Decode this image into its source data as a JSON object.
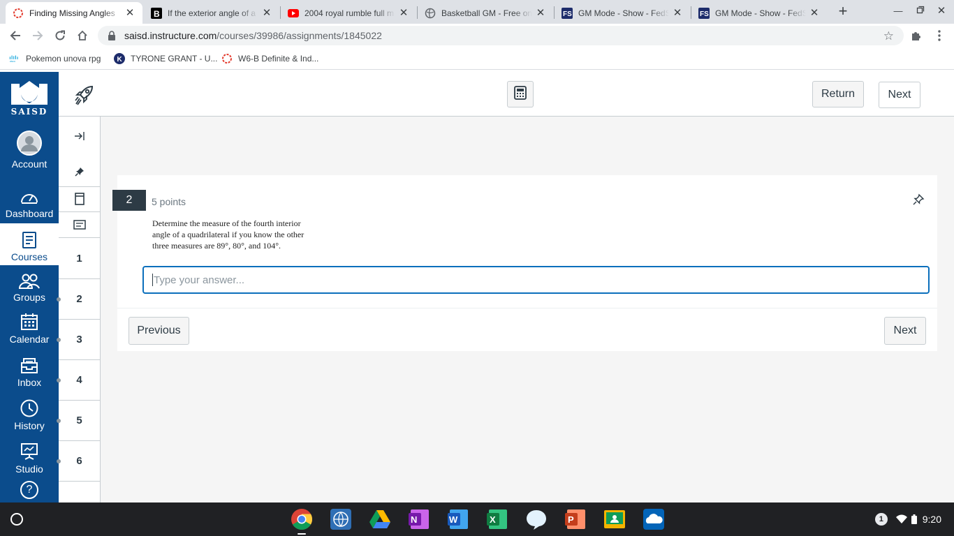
{
  "browser": {
    "tabs": [
      {
        "title": "Finding Missing Angles",
        "active": true
      },
      {
        "title": "If the exterior angle of a",
        "active": false
      },
      {
        "title": "2004 royal rumble full m",
        "active": false
      },
      {
        "title": "Basketball GM - Free onli",
        "active": false
      },
      {
        "title": "GM Mode - Show - FedSi",
        "active": false
      },
      {
        "title": "GM Mode - Show - FedSi",
        "active": false
      }
    ],
    "new_tab": "+",
    "url_host": "saisd.instructure.com",
    "url_path": "/courses/39986/assignments/1845022",
    "bookmarks": [
      {
        "label": "Pokemon unova rpg"
      },
      {
        "label": "TYRONE GRANT - U..."
      },
      {
        "label": "W6-B Definite & Ind..."
      }
    ]
  },
  "nav": {
    "logo_text": "SAISD",
    "items": [
      {
        "label": "Account"
      },
      {
        "label": "Dashboard"
      },
      {
        "label": "Courses"
      },
      {
        "label": "Groups"
      },
      {
        "label": "Calendar"
      },
      {
        "label": "Inbox"
      },
      {
        "label": "History"
      },
      {
        "label": "Studio"
      }
    ],
    "help_label": "?"
  },
  "header": {
    "return_label": "Return",
    "next_label": "Next"
  },
  "question_nav": {
    "numbers": [
      "1",
      "2",
      "3",
      "4",
      "5",
      "6"
    ]
  },
  "question": {
    "number": "2",
    "points": "5 points",
    "text": "Determine the measure of the fourth interior angle of a quadrilateral if you know the other three measures are 89°, 80°, and 104°.",
    "answer_placeholder": "Type your answer...",
    "previous_label": "Previous",
    "next_label": "Next"
  },
  "taskbar": {
    "notification_count": "1",
    "time": "9:20"
  }
}
